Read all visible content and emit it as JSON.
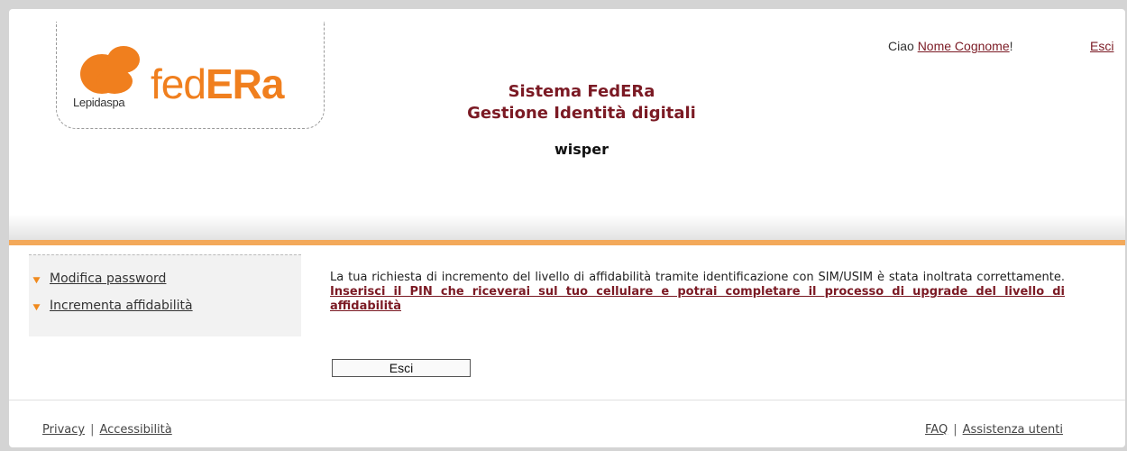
{
  "header": {
    "logo_small_text": "Lepidaspa",
    "logo_fed": "fed",
    "logo_era": "ERa",
    "title_line1": "Sistema FedERa",
    "title_line2": "Gestione Identità digitali",
    "username": "wisper",
    "greeting": "Ciao",
    "user_fullname": "Nome Cognome",
    "greeting_suffix": "!",
    "logout_link": "Esci"
  },
  "sidebar": {
    "items": [
      {
        "label": "Modifica password"
      },
      {
        "label": "Incrementa affidabilità"
      }
    ]
  },
  "main": {
    "message": "La tua richiesta di incremento del livello di affidabilità tramite identificazione con SIM/USIM è stata inoltrata correttamente.",
    "highlight": "Inserisci il PIN che riceverai sul tuo cellulare e potrai completare il processo di upgrade del livello di affidabilità",
    "exit_button": "Esci"
  },
  "footer": {
    "privacy": "Privacy",
    "accessibility": "Accessibilità",
    "faq": "FAQ",
    "support": "Assistenza utenti",
    "separator": "|"
  },
  "colors": {
    "brand_orange": "#f07f1e",
    "title_red": "#7b1a24",
    "accent_band": "#f3a95a"
  }
}
